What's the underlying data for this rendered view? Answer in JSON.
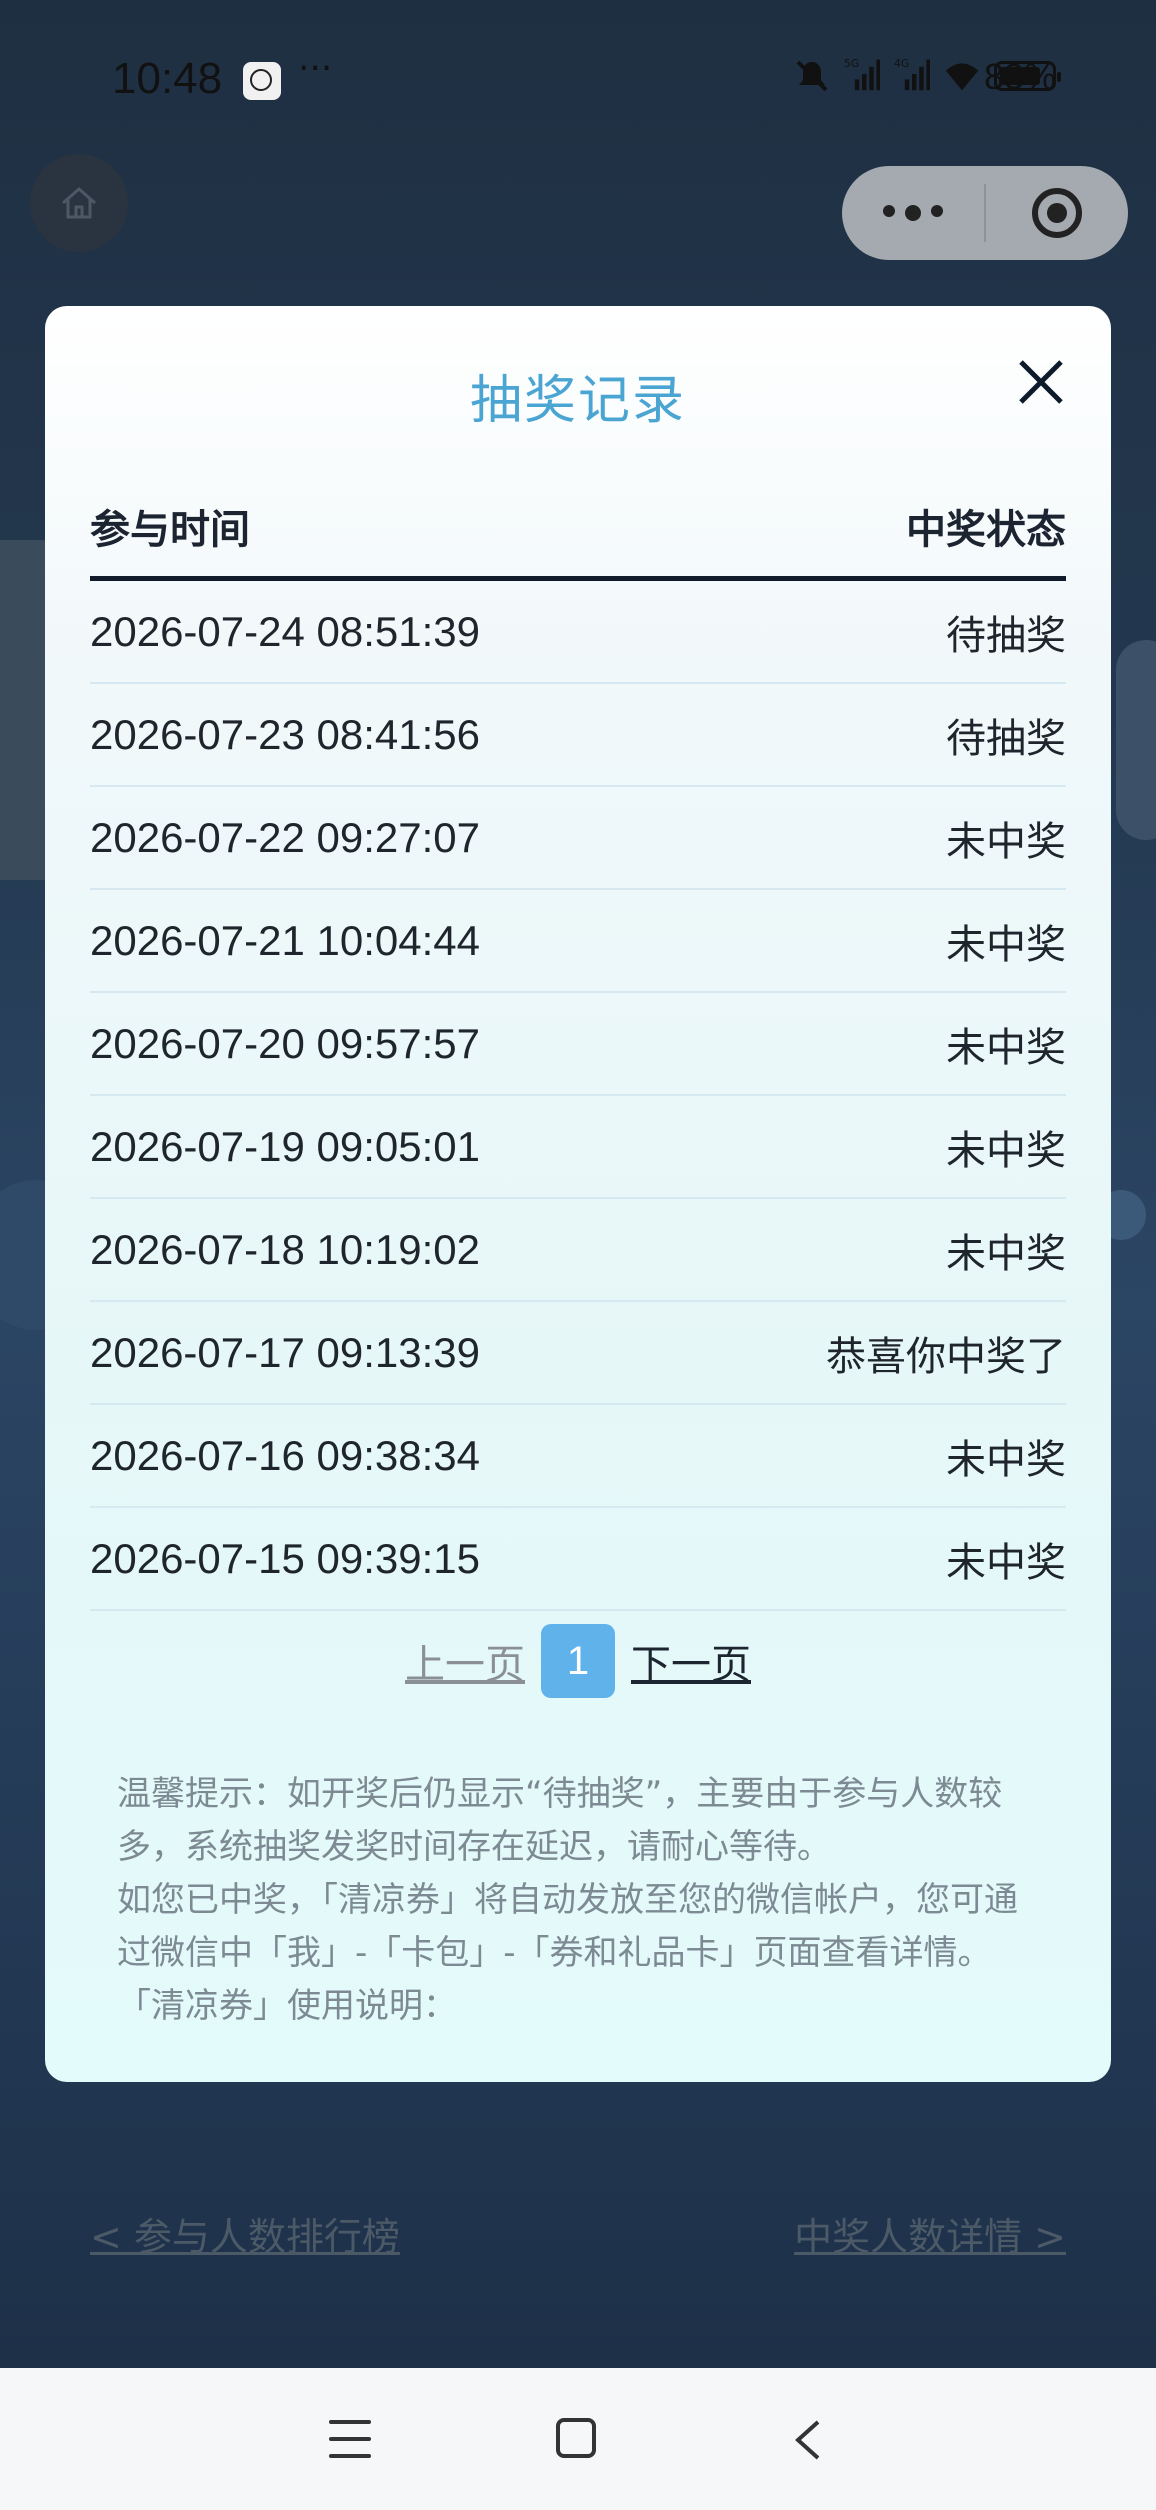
{
  "status_bar": {
    "time": "10:48",
    "ellipsis": "···",
    "network_5g": "5G",
    "network_4g": "4G",
    "battery": "83%"
  },
  "modal": {
    "title": "抽奖记录",
    "columns": [
      "参与时间",
      "中奖状态"
    ],
    "records": [
      {
        "time": "2026-07-24 08:51:39",
        "status": "待抽奖"
      },
      {
        "time": "2026-07-23 08:41:56",
        "status": "待抽奖"
      },
      {
        "time": "2026-07-22 09:27:07",
        "status": "未中奖"
      },
      {
        "time": "2026-07-21 10:04:44",
        "status": "未中奖"
      },
      {
        "time": "2026-07-20 09:57:57",
        "status": "未中奖"
      },
      {
        "time": "2026-07-19 09:05:01",
        "status": "未中奖"
      },
      {
        "time": "2026-07-18 10:19:02",
        "status": "未中奖"
      },
      {
        "time": "2026-07-17 09:13:39",
        "status": "恭喜你中奖了"
      },
      {
        "time": "2026-07-16 09:38:34",
        "status": "未中奖"
      },
      {
        "time": "2026-07-15 09:39:15",
        "status": "未中奖"
      }
    ],
    "pagination": {
      "prev": "上一页",
      "current": "1",
      "next": "下一页"
    },
    "tips": [
      "温馨提示：如开奖后仍显示“待抽奖”，主要由于参与人数较多，系统抽奖发奖时间存在延迟，请耐心等待。",
      "如您已中奖，「清凉券」将自动发放至您的微信帐户，您可通过微信中「我」-「卡包」-「券和礼品卡」页面查看详情。",
      "「清凉券」使用说明："
    ]
  },
  "page_links": {
    "left": "< 参与人数排行榜",
    "right": "中奖人数详情 >"
  }
}
